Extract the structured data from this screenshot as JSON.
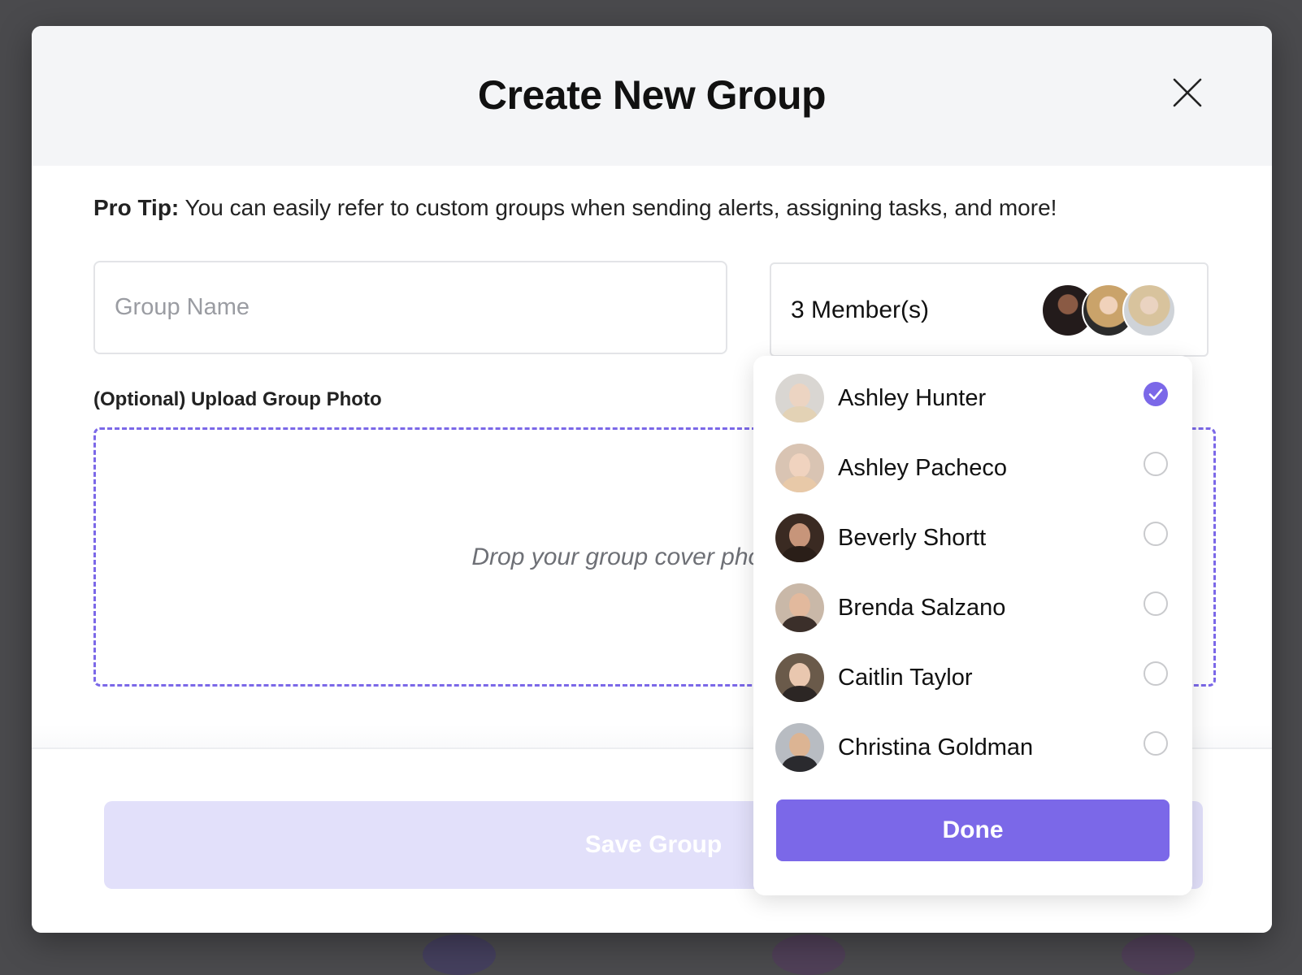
{
  "modal": {
    "title": "Create New Group",
    "pro_tip_label": "Pro Tip:",
    "pro_tip_text": " You can easily refer to custom groups when sending alerts, assigning tasks, and more!"
  },
  "group_name": {
    "value": "",
    "placeholder": "Group Name"
  },
  "members_selector": {
    "count_label": "3 Member(s)",
    "stack_avatars": [
      "avatar-1",
      "avatar-2",
      "avatar-3"
    ]
  },
  "upload": {
    "label": "(Optional) Upload Group Photo",
    "drop_text": "Drop your group cover photo here"
  },
  "footer": {
    "save_label": "Save Group"
  },
  "dropdown": {
    "members": [
      {
        "name": "Ashley Hunter",
        "selected": true
      },
      {
        "name": "Ashley Pacheco",
        "selected": false
      },
      {
        "name": "Beverly Shortt",
        "selected": false
      },
      {
        "name": "Brenda Salzano",
        "selected": false
      },
      {
        "name": "Caitlin Taylor",
        "selected": false
      },
      {
        "name": "Christina Goldman",
        "selected": false
      }
    ],
    "done_label": "Done"
  },
  "colors": {
    "accent": "#7b68e8",
    "save_disabled": "#e2e0fa",
    "header_bg": "#f4f5f7",
    "overlay": "#4a4a4d"
  },
  "icons": {
    "close": "close-icon",
    "check": "check-icon"
  }
}
